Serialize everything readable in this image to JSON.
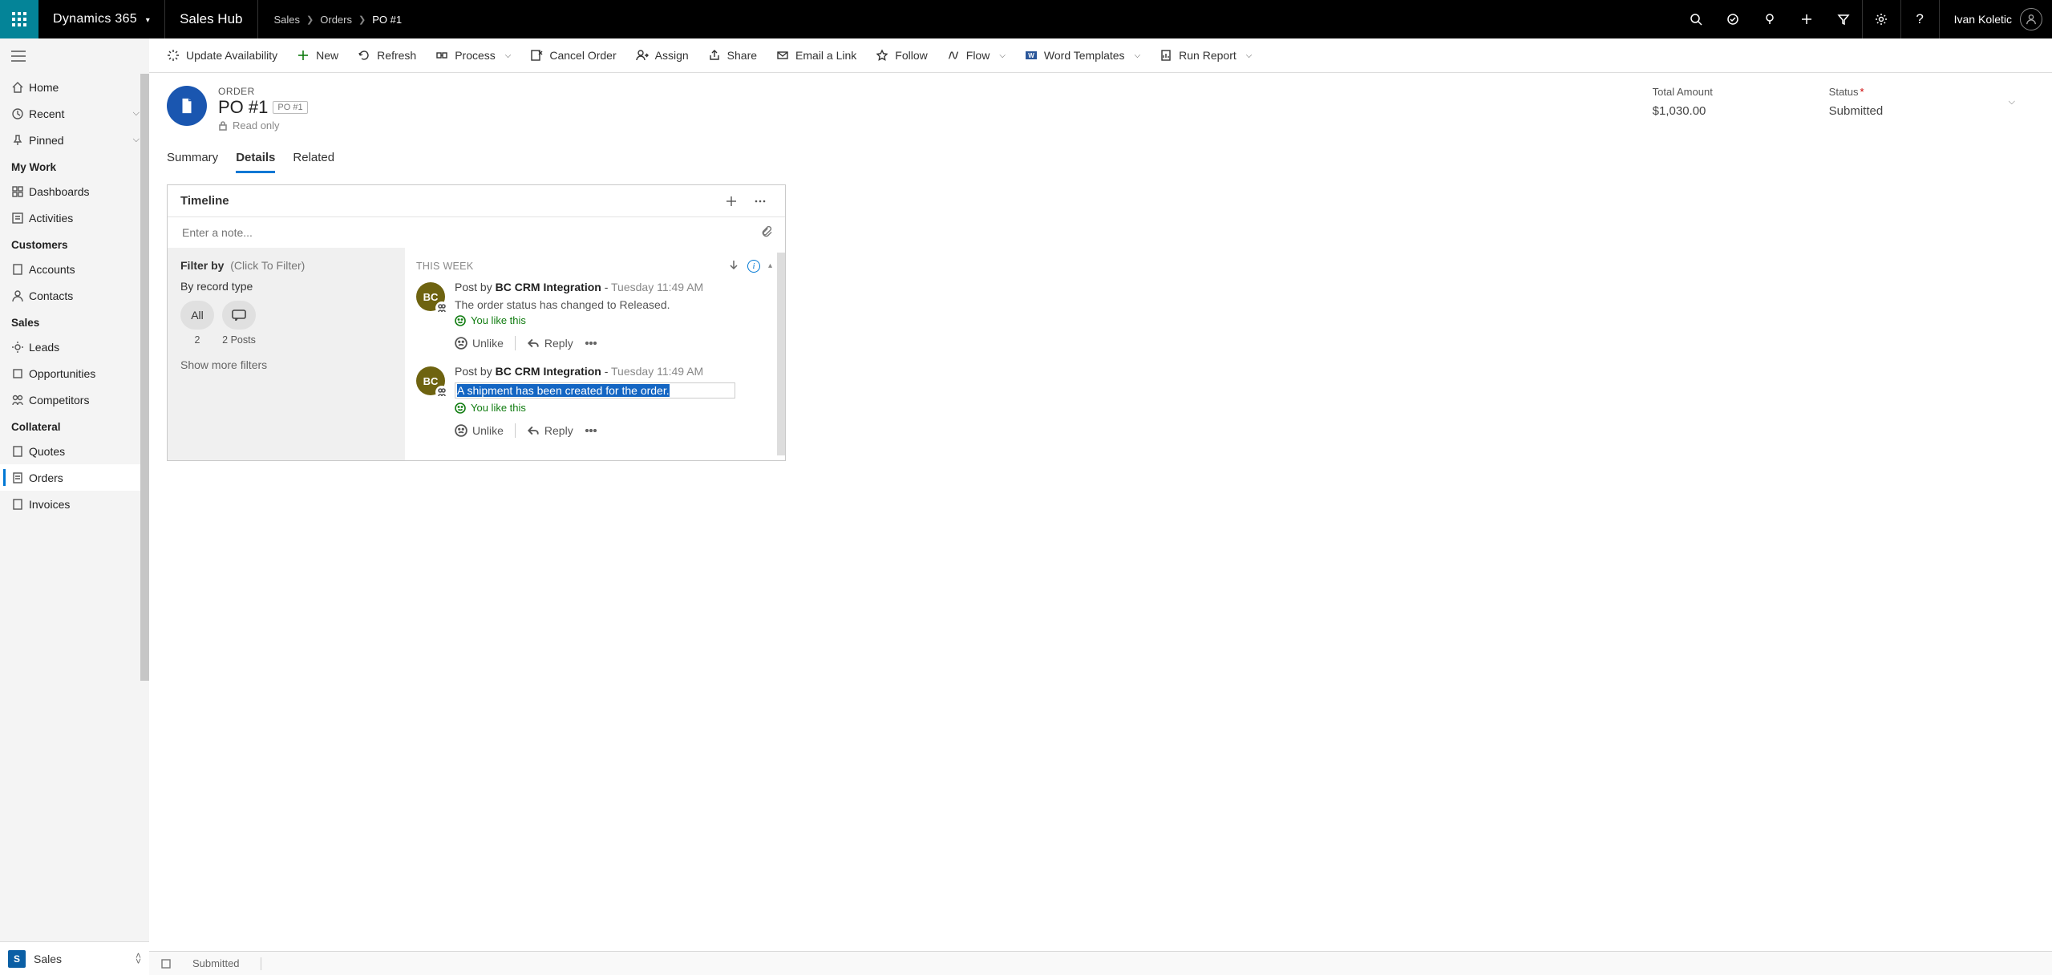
{
  "topbar": {
    "brand": "Dynamics 365",
    "app": "Sales Hub",
    "user": "Ivan Koletic"
  },
  "breadcrumbs": [
    "Sales",
    "Orders",
    "PO #1"
  ],
  "commands": {
    "update_availability": "Update Availability",
    "new": "New",
    "refresh": "Refresh",
    "process": "Process",
    "cancel_order": "Cancel Order",
    "assign": "Assign",
    "share": "Share",
    "email_link": "Email a Link",
    "follow": "Follow",
    "flow": "Flow",
    "word_templates": "Word Templates",
    "run_report": "Run Report"
  },
  "leftnav": {
    "home": "Home",
    "recent": "Recent",
    "pinned": "Pinned",
    "groups": {
      "mywork": {
        "title": "My Work",
        "items": [
          "Dashboards",
          "Activities"
        ]
      },
      "customers": {
        "title": "Customers",
        "items": [
          "Accounts",
          "Contacts"
        ]
      },
      "sales": {
        "title": "Sales",
        "items": [
          "Leads",
          "Opportunities",
          "Competitors"
        ]
      },
      "collateral": {
        "title": "Collateral",
        "items": [
          "Quotes",
          "Orders",
          "Invoices"
        ]
      }
    },
    "area": "Sales",
    "area_badge": "S"
  },
  "record": {
    "entity_type": "ORDER",
    "name": "PO #1",
    "badge": "PO #1",
    "readonly": "Read only",
    "fields": {
      "total_amount": {
        "label": "Total Amount",
        "value": "$1,030.00"
      },
      "status": {
        "label": "Status",
        "value": "Submitted",
        "required": true
      }
    }
  },
  "tabs": [
    "Summary",
    "Details",
    "Related"
  ],
  "active_tab": "Details",
  "timeline": {
    "title": "Timeline",
    "note_placeholder": "Enter a note...",
    "filter": {
      "label": "Filter by",
      "click": "(Click To Filter)",
      "by_record": "By record type",
      "pill_all": "All",
      "count_all": "2",
      "count_posts": "2 Posts",
      "show_more": "Show more filters"
    },
    "week_label": "THIS WEEK",
    "posts": [
      {
        "avatar": "BC",
        "prefix": "Post by ",
        "author": "BC CRM Integration",
        "sep": " -  ",
        "timestamp": "Tuesday 11:49 AM",
        "message": "The order status has changed to Released.",
        "like": "You like this",
        "unlike": "Unlike",
        "reply": "Reply",
        "selected": false
      },
      {
        "avatar": "BC",
        "prefix": "Post by ",
        "author": "BC CRM Integration",
        "sep": " -  ",
        "timestamp": "Tuesday 11:49 AM",
        "message": "A shipment has been created for the order.",
        "like": "You like this",
        "unlike": "Unlike",
        "reply": "Reply",
        "selected": true
      }
    ]
  },
  "statusbar": {
    "status": "Submitted"
  }
}
